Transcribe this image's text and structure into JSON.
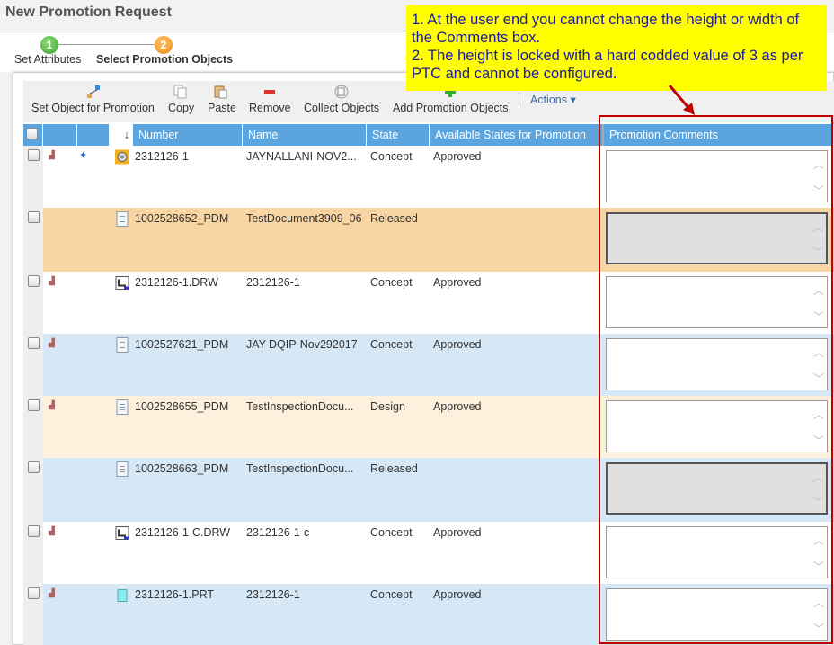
{
  "title": "New Promotion Request",
  "wizard": {
    "steps": [
      {
        "num": "1",
        "label": "Set Attributes"
      },
      {
        "num": "2",
        "label": "Select Promotion Objects"
      }
    ]
  },
  "toolbar": {
    "set_object": "Set Object for Promotion",
    "copy": "Copy",
    "paste": "Paste",
    "remove": "Remove",
    "collect": "Collect Objects",
    "add": "Add Promotion Objects",
    "actions": "Actions ▾"
  },
  "columns": {
    "number": "Number",
    "name": "Name",
    "state": "State",
    "available": "Available States for Promotion",
    "comments": "Promotion Comments"
  },
  "rows": [
    {
      "number": "2312126-1",
      "name": "JAYNALLANI-NOV2...",
      "state": "Concept",
      "available": "Approved",
      "icon": "part-gear-icon",
      "bg": "#ffffff",
      "disabled": false
    },
    {
      "number": "1002528652_PDM",
      "name": "TestDocument3909_06",
      "state": "Released",
      "available": "",
      "icon": "document-icon",
      "bg": "#f8d5a3",
      "disabled": true
    },
    {
      "number": "2312126-1.DRW",
      "name": "2312126-1",
      "state": "Concept",
      "available": "Approved",
      "icon": "drawing-icon",
      "bg": "#ffffff",
      "disabled": false
    },
    {
      "number": "1002527621_PDM",
      "name": "JAY-DQIP-Nov292017",
      "state": "Concept",
      "available": "Approved",
      "icon": "document-icon",
      "bg": "#d6e8f6",
      "disabled": false
    },
    {
      "number": "1002528655_PDM",
      "name": "TestInspectionDocu...",
      "state": "Design",
      "available": "Approved",
      "icon": "document-icon",
      "bg": "#fdf0dd",
      "disabled": false
    },
    {
      "number": "1002528663_PDM",
      "name": "TestInspectionDocu...",
      "state": "Released",
      "available": "",
      "icon": "document-icon",
      "bg": "#d6e8f6",
      "disabled": true
    },
    {
      "number": "2312126-1-C.DRW",
      "name": "2312126-1-c",
      "state": "Concept",
      "available": "Approved",
      "icon": "drawing-icon",
      "bg": "#ffffff",
      "disabled": false
    },
    {
      "number": "2312126-1.PRT",
      "name": "2312126-1",
      "state": "Concept",
      "available": "Approved",
      "icon": "part-icon",
      "bg": "#d6e8f6",
      "disabled": false
    }
  ],
  "note": {
    "line1": "1. At the user end you cannot change the height or width of the Comments box.",
    "line2": "2. The height is locked with a hard codded value of 3 as per PTC and cannot be configured."
  }
}
